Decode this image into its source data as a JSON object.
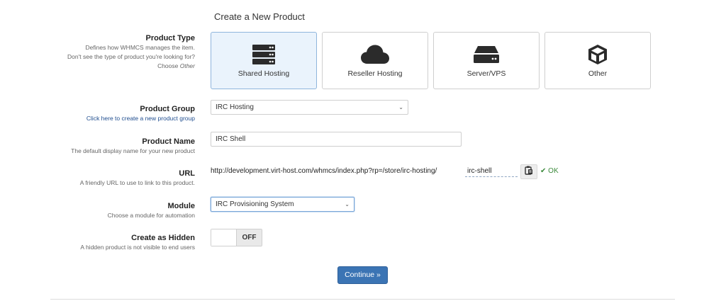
{
  "page": {
    "title": "Create a New Product"
  },
  "product_type": {
    "label": "Product Type",
    "help_line1": "Defines how WHMCS manages the item.",
    "help_line2": "Don't see the type of product you're looking for?",
    "help_line3_prefix": "Choose ",
    "help_line3_em": "Other",
    "options": [
      {
        "label": "Shared Hosting",
        "icon": "server-stack-icon",
        "selected": true
      },
      {
        "label": "Reseller Hosting",
        "icon": "cloud-icon",
        "selected": false
      },
      {
        "label": "Server/VPS",
        "icon": "hard-drive-icon",
        "selected": false
      },
      {
        "label": "Other",
        "icon": "cube-icon",
        "selected": false
      }
    ]
  },
  "product_group": {
    "label": "Product Group",
    "link": "Click here to create a new product group",
    "value": "IRC Hosting"
  },
  "product_name": {
    "label": "Product Name",
    "help": "The default display name for your new product",
    "value": "IRC Shell"
  },
  "url": {
    "label": "URL",
    "help": "A friendly URL to use to link to this product.",
    "base": "http://development.virt-host.com/whmcs/index.php?rp=/store/irc-hosting/",
    "slug": "irc-shell",
    "status": "OK"
  },
  "module": {
    "label": "Module",
    "help": "Choose a module for automation",
    "value": "IRC Provisioning System"
  },
  "hidden": {
    "label": "Create as Hidden",
    "help": "A hidden product is not visible to end users",
    "state": "OFF"
  },
  "actions": {
    "continue": "Continue »"
  },
  "colors": {
    "accent": "#3b74b4",
    "selected_card": "#eaf3fc",
    "ok": "#3c8a3c"
  }
}
